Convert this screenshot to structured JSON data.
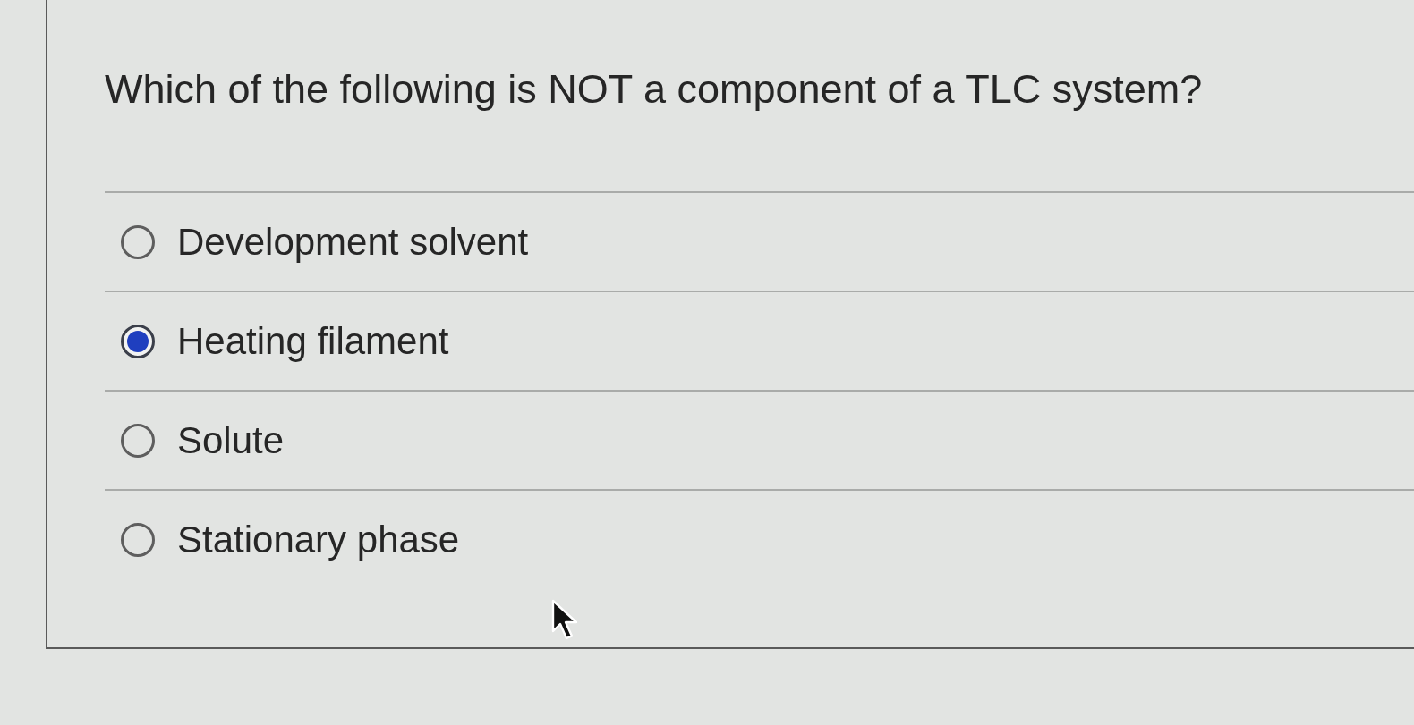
{
  "question": "Which of the following is NOT a component of a TLC system?",
  "options": [
    {
      "label": "Development solvent",
      "selected": false
    },
    {
      "label": "Heating filament",
      "selected": true
    },
    {
      "label": "Solute",
      "selected": false
    },
    {
      "label": "Stationary phase",
      "selected": false
    }
  ]
}
